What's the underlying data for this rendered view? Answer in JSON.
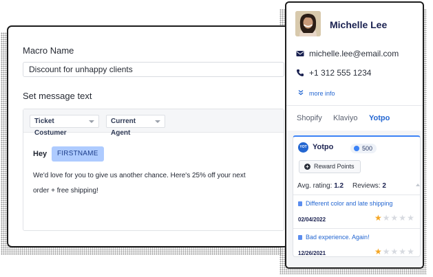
{
  "macro": {
    "name_label": "Macro Name",
    "name_value": "Discount for unhappy clients",
    "message_label": "Set message text",
    "toolbar": {
      "ticket_select": "Ticket Costumer",
      "agent_select": "Current Agent"
    },
    "greeting": "Hey",
    "variable_tag": "FIRSTNAME",
    "body_line_1": "We'd love for you to give us another chance. Here's 25% off your next",
    "body_line_2": "order + free shipping!"
  },
  "customer": {
    "name": "Michelle Lee",
    "email": "michelle.lee@email.com",
    "phone": "+1 312 555 1234",
    "more_info": "more info",
    "avatar_icon": "avatar-photo"
  },
  "tabs": [
    {
      "label": "Shopify",
      "active": false
    },
    {
      "label": "Klaviyo",
      "active": false
    },
    {
      "label": "Yotpo",
      "active": true
    }
  ],
  "yotpo": {
    "logo_text": "YOT PO",
    "title": "Yotpo",
    "points": "500",
    "reward_button": "Reward Points",
    "avg_rating_label": "Avg. rating:",
    "avg_rating_value": "1.2",
    "reviews_label": "Reviews:",
    "reviews_value": "2",
    "reviews": [
      {
        "title": "Different color and late shipping",
        "date": "02/04/2022",
        "rating": 1,
        "max": 5
      },
      {
        "title": "Bad experience. Again!",
        "date": "12/26/2021",
        "rating": 1,
        "max": 5
      }
    ]
  },
  "colors": {
    "accent": "#2366d1",
    "tag_bg": "#aecbff",
    "star_on": "#f5a623",
    "star_off": "#d7dae0"
  }
}
